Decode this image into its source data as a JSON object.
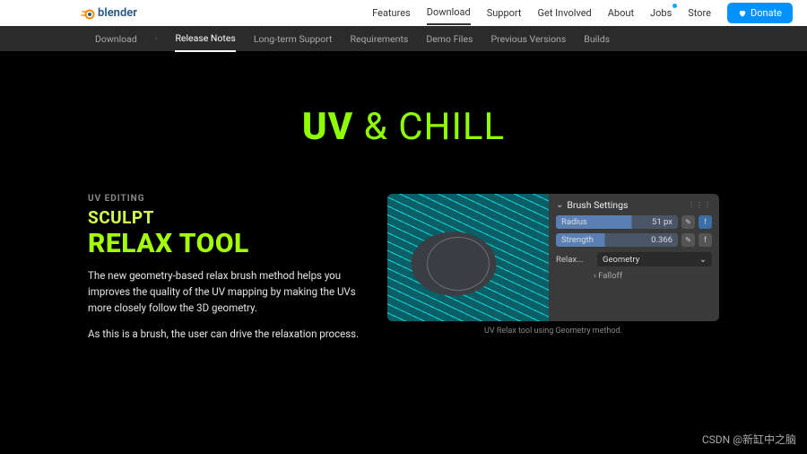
{
  "brand": "blender",
  "topnav": [
    "Features",
    "Download",
    "Support",
    "Get Involved",
    "About",
    "Jobs",
    "Store"
  ],
  "topnav_active": 1,
  "topnav_dot": 5,
  "donate": "Donate",
  "subnav": {
    "lead": "Download",
    "items": [
      "Release Notes",
      "Long-term Support",
      "Requirements",
      "Demo Files",
      "Previous Versions",
      "Builds"
    ],
    "active": 0
  },
  "hero": {
    "a": "UV",
    "b": " & CHILL"
  },
  "section": {
    "eyebrow": "UV EDITING",
    "h2a": "SCULPT",
    "h2b": "RELAX TOOL",
    "p1": "The new geometry-based relax brush method helps you improves the quality of the UV mapping by making the UVs more closely follow the 3D geometry.",
    "p2": "As this is a brush, the user can drive the relaxation process."
  },
  "panel": {
    "title": "Brush Settings",
    "radius": {
      "label": "Radius",
      "value": "51 px"
    },
    "strength": {
      "label": "Strength",
      "value": "0.366"
    },
    "relax": {
      "label": "Relax...",
      "value": "Geometry"
    },
    "falloff": "Falloff"
  },
  "caption": "UV Relax tool using Geometry method.",
  "watermark": "CSDN @新缸中之脑"
}
